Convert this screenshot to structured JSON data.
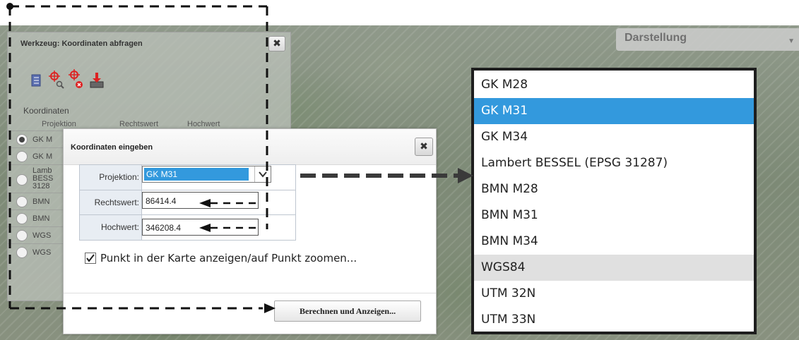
{
  "map": {
    "overlay_select": "Darstellung"
  },
  "tool_panel": {
    "title": "Werkzeug: Koordinaten abfragen",
    "close_symbol": "✖",
    "toolbar_icons": [
      "document-icon",
      "crosshair-zoom-icon",
      "crosshair-delete-icon",
      "download-icon"
    ],
    "section_label": "Koordinaten",
    "columns": [
      "Projektion",
      "Rechtswert",
      "Hochwert"
    ],
    "rows": [
      {
        "name": "GK M",
        "selected": true
      },
      {
        "name": "GK M",
        "selected": false
      },
      {
        "name": "Lamb BESS 3128",
        "selected": false
      },
      {
        "name": "BMN",
        "selected": false
      },
      {
        "name": "BMN",
        "selected": false
      },
      {
        "name": "WGS",
        "selected": false
      },
      {
        "name": "WGS",
        "selected": false
      }
    ]
  },
  "dialog": {
    "title": "Koordinaten eingeben",
    "close_symbol": "✖",
    "projektion_label": "Projektion:",
    "projektion_value": "GK M31",
    "rechtswert_label": "Rechtswert:",
    "rechtswert_value": "86414.4",
    "hochwert_label": "Hochwert:",
    "hochwert_value": "346208.4",
    "checkbox_label": "Punkt in der Karte anzeigen/auf Punkt zoomen...",
    "checkbox_checked": true,
    "submit_label": "Berechnen und Anzeigen..."
  },
  "projection_options": {
    "items": [
      "GK M28",
      "GK M31",
      "GK M34",
      "Lambert BESSEL (EPSG 31287)",
      "BMN M28",
      "BMN M31",
      "BMN M34",
      "WGS84",
      "UTM 32N",
      "UTM 33N"
    ],
    "selected": "GK M31",
    "highlighted": "WGS84"
  },
  "colors": {
    "selection": "#3399dd",
    "hover": "#e0e0e0",
    "guide": "#111111"
  }
}
